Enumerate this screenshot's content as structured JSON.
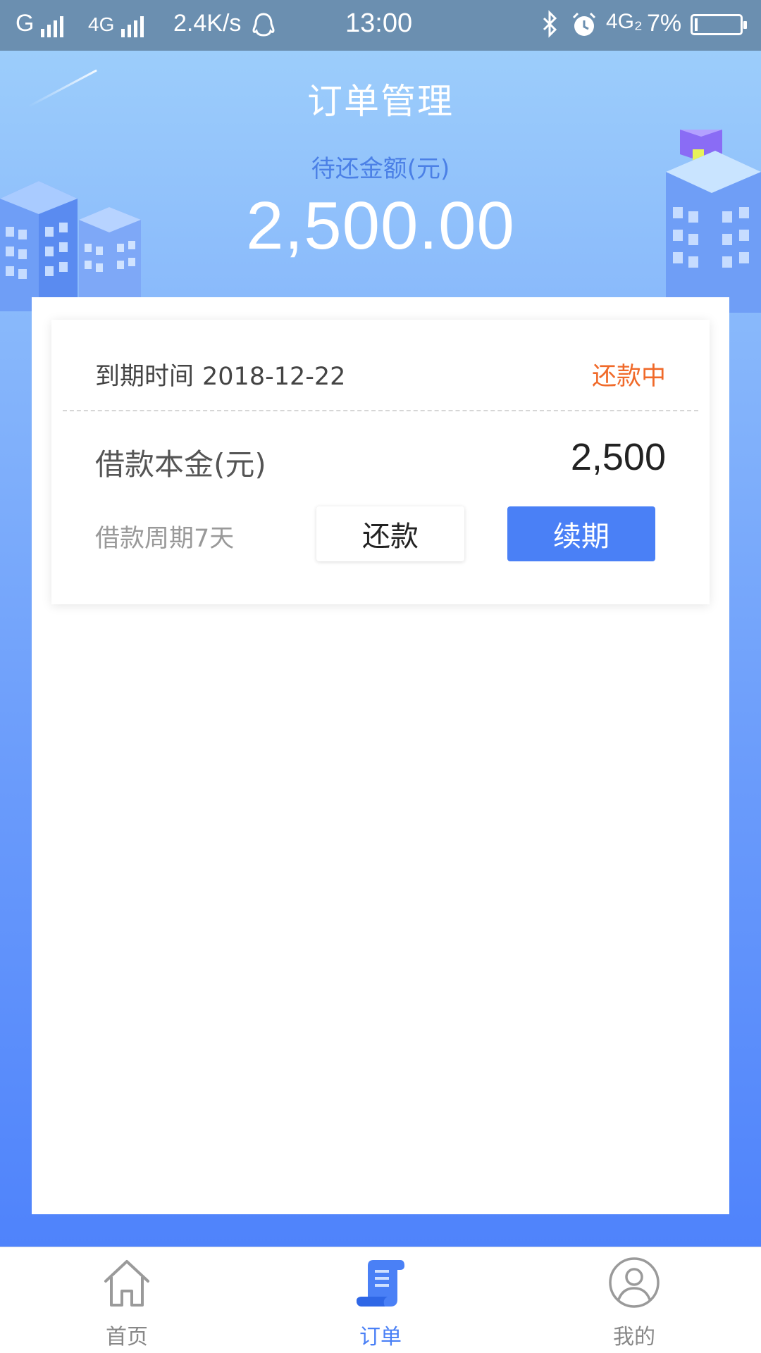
{
  "status_bar": {
    "carrier1": "G",
    "carrier2": "4G",
    "speed": "2.4K/s",
    "time": "13:00",
    "network": "4G₂",
    "battery": "7%",
    "battery_level": 0.07
  },
  "header": {
    "title": "订单管理",
    "amount_label": "待还金额(元)",
    "amount": "2,500.00"
  },
  "order": {
    "due_label": "到期时间",
    "due_date": "2018-12-22",
    "status": "还款中",
    "principal_label": "借款本金(元)",
    "principal_value": "2,500",
    "period": "借款周期7天",
    "repay_button": "还款",
    "renew_button": "续期"
  },
  "tabs": [
    {
      "label": "首页",
      "icon": "home-icon",
      "active": false
    },
    {
      "label": "订单",
      "icon": "order-scroll-icon",
      "active": true
    },
    {
      "label": "我的",
      "icon": "user-icon",
      "active": false
    }
  ],
  "colors": {
    "accent": "#4a80f6",
    "status_orange": "#f06a2a",
    "header_top": "#9ccdfb",
    "header_bottom": "#4f83fb"
  }
}
